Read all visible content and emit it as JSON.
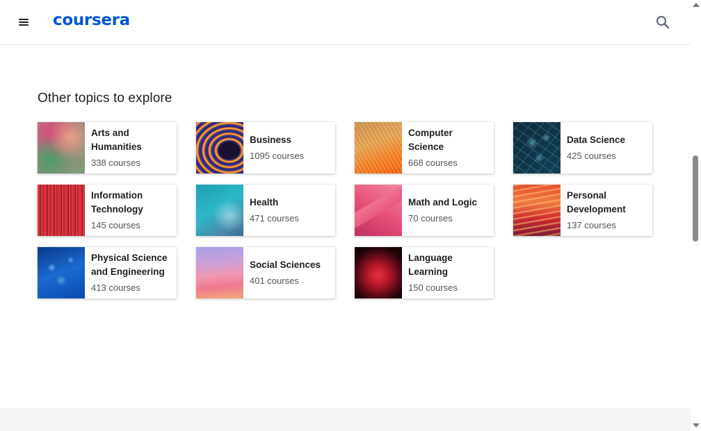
{
  "header": {
    "logo_text": "coursera",
    "brand_color": "#0056d2",
    "menu_icon": "hamburger-menu-icon",
    "search_icon": "search-icon"
  },
  "section": {
    "title": "Other topics to explore"
  },
  "topics": [
    {
      "name": "Arts and Humanities",
      "count": "338 courses",
      "thumb": "arts"
    },
    {
      "name": "Business",
      "count": "1095 courses",
      "thumb": "business"
    },
    {
      "name": "Computer Science",
      "count": "668 courses",
      "thumb": "cs"
    },
    {
      "name": "Data Science",
      "count": "425 courses",
      "thumb": "datasci"
    },
    {
      "name": "Information Technology",
      "count": "145 courses",
      "thumb": "it"
    },
    {
      "name": "Health",
      "count": "471 courses",
      "thumb": "health"
    },
    {
      "name": "Math and Logic",
      "count": "70 courses",
      "thumb": "math"
    },
    {
      "name": "Personal Development",
      "count": "137 courses",
      "thumb": "personal"
    },
    {
      "name": "Physical Science and Engineering",
      "count": "413 courses",
      "thumb": "physical"
    },
    {
      "name": "Social Sciences",
      "count": "401 courses",
      "thumb": "social"
    },
    {
      "name": "Language Learning",
      "count": "150 courses",
      "thumb": "language"
    }
  ]
}
